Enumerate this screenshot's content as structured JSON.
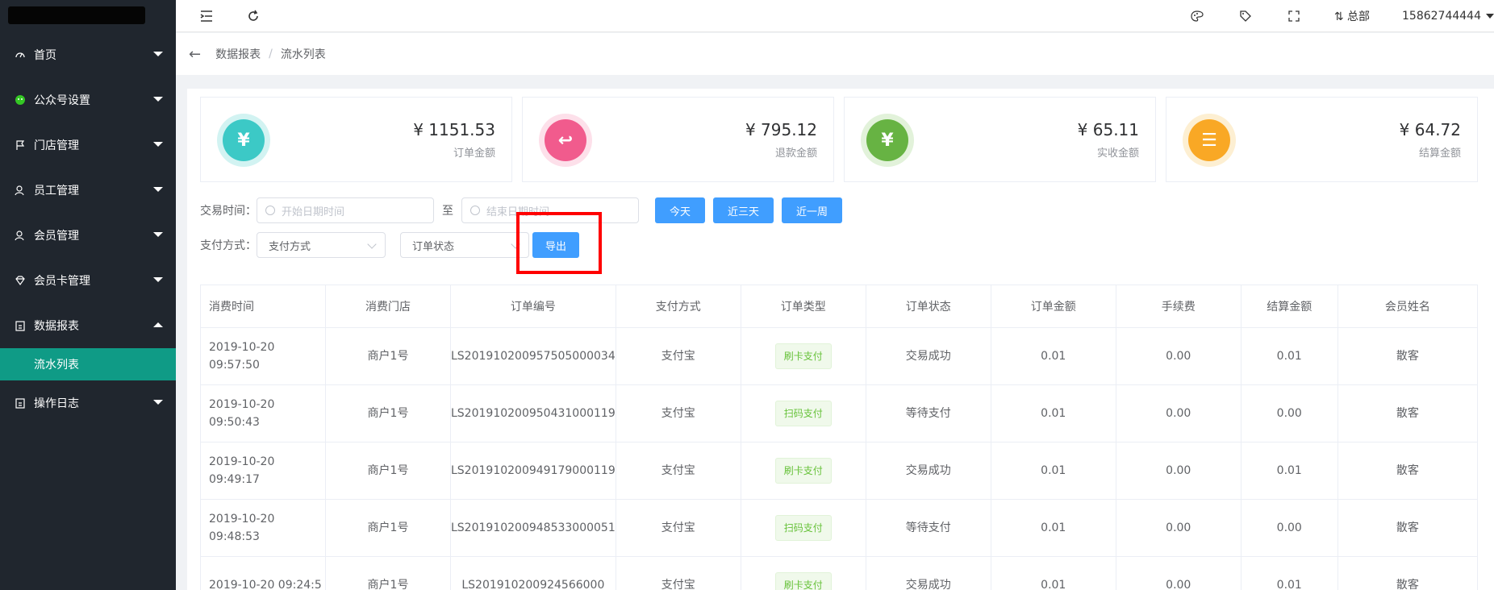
{
  "sidebar": {
    "items": [
      {
        "label": "首页",
        "icon": "dashboard-icon"
      },
      {
        "label": "公众号设置",
        "icon": "wechat-icon"
      },
      {
        "label": "门店管理",
        "icon": "flag-icon"
      },
      {
        "label": "员工管理",
        "icon": "user-icon"
      },
      {
        "label": "会员管理",
        "icon": "member-icon"
      },
      {
        "label": "会员卡管理",
        "icon": "diamond-icon"
      },
      {
        "label": "数据报表",
        "icon": "report-icon"
      },
      {
        "label": "操作日志",
        "icon": "log-icon"
      }
    ],
    "sub_item": "流水列表"
  },
  "topbar": {
    "store": "总部",
    "user": "15862744444"
  },
  "breadcrumb": {
    "parent": "数据报表",
    "current": "流水列表"
  },
  "cards": [
    {
      "amount": "¥ 1151.53",
      "label": "订单金额",
      "color": "#3cc9c6",
      "icon": "money-bag-icon"
    },
    {
      "amount": "¥ 795.12",
      "label": "退款金额",
      "color": "#f15b8d",
      "icon": "refund-icon"
    },
    {
      "amount": "¥ 65.11",
      "label": "实收金额",
      "color": "#67b343",
      "icon": "shield-yen-icon"
    },
    {
      "amount": "¥ 64.72",
      "label": "结算金额",
      "color": "#f9a825",
      "icon": "document-icon"
    }
  ],
  "filters": {
    "time_label": "交易时间：",
    "start_placeholder": "开始日期时间",
    "to_label": "至",
    "end_placeholder": "结束日期时间",
    "btn_today": "今天",
    "btn_3days": "近三天",
    "btn_week": "近一周",
    "pay_label": "支付方式：",
    "pay_select": "支付方式",
    "status_select": "订单状态",
    "export_btn": "导出"
  },
  "table": {
    "headers": [
      "消费时间",
      "消费门店",
      "订单编号",
      "支付方式",
      "订单类型",
      "订单状态",
      "订单金额",
      "手续费",
      "结算金额",
      "会员姓名"
    ],
    "rows": [
      {
        "time": "2019-10-20 09:57:50",
        "store": "商户1号",
        "order": "LS201910200957505000034",
        "pay": "支付宝",
        "type": "刷卡支付",
        "status": "交易成功",
        "status_kind": "ok",
        "amount": "0.01",
        "fee": "0.00",
        "settle": "0.01",
        "member": "散客"
      },
      {
        "time": "2019-10-20 09:50:43",
        "store": "商户1号",
        "order": "LS201910200950431000119",
        "pay": "支付宝",
        "type": "扫码支付",
        "status": "等待支付",
        "status_kind": "wait",
        "amount": "0.01",
        "fee": "0.00",
        "settle": "0.00",
        "member": "散客"
      },
      {
        "time": "2019-10-20 09:49:17",
        "store": "商户1号",
        "order": "LS201910200949179000119",
        "pay": "支付宝",
        "type": "刷卡支付",
        "status": "交易成功",
        "status_kind": "ok",
        "amount": "0.01",
        "fee": "0.00",
        "settle": "0.01",
        "member": "散客"
      },
      {
        "time": "2019-10-20 09:48:53",
        "store": "商户1号",
        "order": "LS201910200948533000051",
        "pay": "支付宝",
        "type": "扫码支付",
        "status": "等待支付",
        "status_kind": "wait",
        "amount": "0.01",
        "fee": "0.00",
        "settle": "0.00",
        "member": "散客"
      },
      {
        "time": "2019-10-20 09:24:5",
        "store": "商户1号",
        "order": "LS201910200924566000",
        "pay": "支付宝",
        "type": "刷卡支付",
        "status": "交易成功",
        "status_kind": "ok",
        "amount": "0.01",
        "fee": "0.00",
        "settle": "0.01",
        "member": "散客"
      }
    ]
  }
}
